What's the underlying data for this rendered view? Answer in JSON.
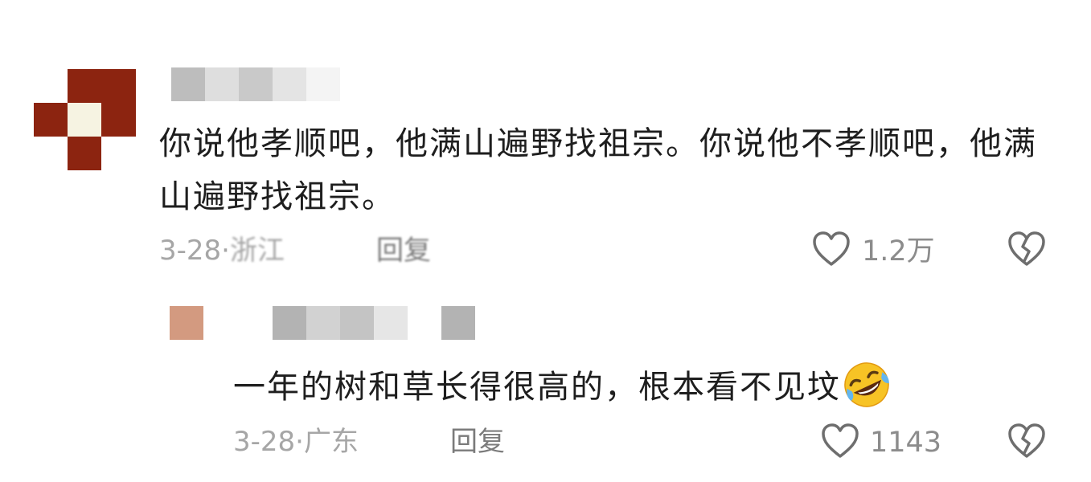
{
  "comment": {
    "text": "你说他孝顺吧，他满山遍野找祖宗。你说他不孝顺吧，他满山遍野找祖宗。",
    "date": "3-28",
    "sep": "·",
    "location": "浙江",
    "reply_label": "回复",
    "like_count": "1.2万",
    "icons": {
      "like": "heart-outline-icon",
      "dislike": "broken-heart-icon"
    }
  },
  "reply": {
    "text": "一年的树和草长得很高的，根本看不见坟",
    "emoji": "rolling-on-floor-laughing-emoji",
    "date": "3-28",
    "sep": "·",
    "location": "广东",
    "reply_label": "回复",
    "like_count": "1143",
    "icons": {
      "like": "heart-outline-icon",
      "dislike": "broken-heart-icon"
    }
  },
  "colors": {
    "text": "#1e1e1e",
    "meta": "#a6a6a6",
    "icon": "#6e6e6e",
    "avatar_red": "#8c2410",
    "avatar_cream": "#f6f3e2",
    "avatar2": "#d39a80"
  }
}
